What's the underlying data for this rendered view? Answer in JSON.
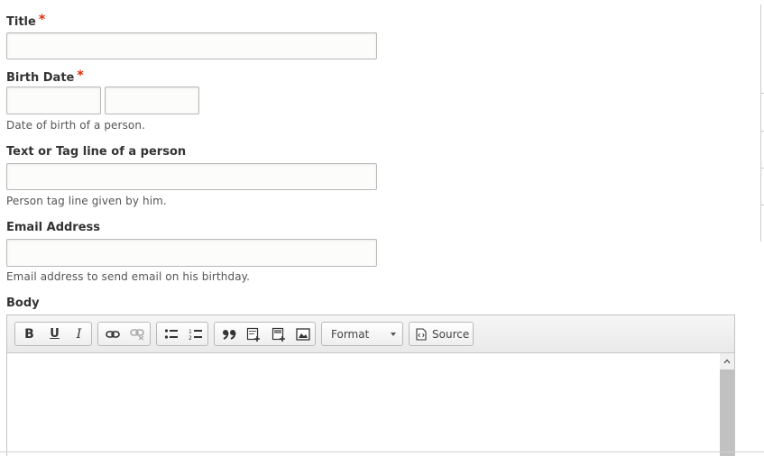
{
  "form": {
    "title": {
      "label": "Title",
      "required_mark": "*"
    },
    "birth_date": {
      "label": "Birth Date",
      "required_mark": "*",
      "description": "Date of birth of a person."
    },
    "tag_line": {
      "label": "Text or Tag line of a person",
      "description": "Person tag line given by him."
    },
    "email": {
      "label": "Email Address",
      "description": "Email address to send email on his birthday."
    },
    "body": {
      "label": "Body"
    }
  },
  "editor": {
    "toolbar": {
      "bold": "B",
      "underline": "U",
      "italic": "I",
      "format_label": "Format",
      "source_label": "Source",
      "icons": [
        "bold-icon",
        "underline-icon",
        "italic-icon",
        "link-icon",
        "unlink-icon",
        "bulleted-list-icon",
        "numbered-list-icon",
        "blockquote-icon",
        "insert-template-icon",
        "insert-block-icon",
        "image-icon",
        "source-icon"
      ]
    }
  },
  "colors": {
    "required": "#e62600",
    "border": "#b8b8b8",
    "toolbar_bg": "#efefef"
  }
}
